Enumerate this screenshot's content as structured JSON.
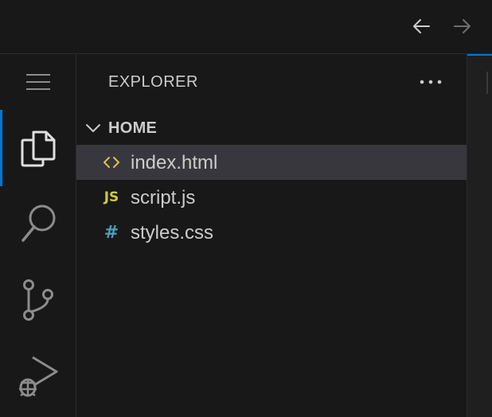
{
  "titlebar": {
    "back_icon": "arrow-left-icon",
    "forward_icon": "arrow-right-icon"
  },
  "activity_bar": {
    "items": [
      {
        "icon": "menu-icon"
      },
      {
        "icon": "files-icon",
        "active": true
      },
      {
        "icon": "search-icon"
      },
      {
        "icon": "source-control-icon"
      },
      {
        "icon": "run-debug-icon"
      }
    ]
  },
  "sidebar": {
    "title": "EXPLORER",
    "section": {
      "label": "HOME",
      "files": [
        {
          "name": "index.html",
          "icon_text": "<>",
          "icon_color": "#e2c04a",
          "selected": true
        },
        {
          "name": "script.js",
          "icon_text": "JS",
          "icon_color": "#cbcb41",
          "selected": false
        },
        {
          "name": "styles.css",
          "icon_text": "#",
          "icon_color": "#519aba",
          "selected": false
        }
      ]
    }
  },
  "colors": {
    "accent": "#0078d4",
    "text": "#cccccc",
    "selection": "#37373d"
  }
}
